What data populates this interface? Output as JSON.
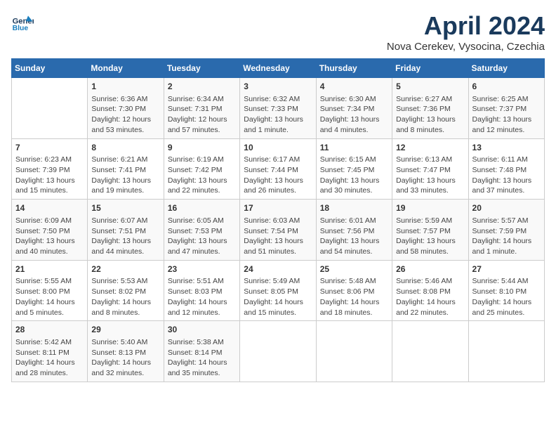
{
  "header": {
    "logo_line1": "General",
    "logo_line2": "Blue",
    "month_title": "April 2024",
    "location": "Nova Cerekev, Vysocina, Czechia"
  },
  "days_of_week": [
    "Sunday",
    "Monday",
    "Tuesday",
    "Wednesday",
    "Thursday",
    "Friday",
    "Saturday"
  ],
  "weeks": [
    [
      {
        "day": "",
        "info": ""
      },
      {
        "day": "1",
        "info": "Sunrise: 6:36 AM\nSunset: 7:30 PM\nDaylight: 12 hours\nand 53 minutes."
      },
      {
        "day": "2",
        "info": "Sunrise: 6:34 AM\nSunset: 7:31 PM\nDaylight: 12 hours\nand 57 minutes."
      },
      {
        "day": "3",
        "info": "Sunrise: 6:32 AM\nSunset: 7:33 PM\nDaylight: 13 hours\nand 1 minute."
      },
      {
        "day": "4",
        "info": "Sunrise: 6:30 AM\nSunset: 7:34 PM\nDaylight: 13 hours\nand 4 minutes."
      },
      {
        "day": "5",
        "info": "Sunrise: 6:27 AM\nSunset: 7:36 PM\nDaylight: 13 hours\nand 8 minutes."
      },
      {
        "day": "6",
        "info": "Sunrise: 6:25 AM\nSunset: 7:37 PM\nDaylight: 13 hours\nand 12 minutes."
      }
    ],
    [
      {
        "day": "7",
        "info": "Sunrise: 6:23 AM\nSunset: 7:39 PM\nDaylight: 13 hours\nand 15 minutes."
      },
      {
        "day": "8",
        "info": "Sunrise: 6:21 AM\nSunset: 7:41 PM\nDaylight: 13 hours\nand 19 minutes."
      },
      {
        "day": "9",
        "info": "Sunrise: 6:19 AM\nSunset: 7:42 PM\nDaylight: 13 hours\nand 22 minutes."
      },
      {
        "day": "10",
        "info": "Sunrise: 6:17 AM\nSunset: 7:44 PM\nDaylight: 13 hours\nand 26 minutes."
      },
      {
        "day": "11",
        "info": "Sunrise: 6:15 AM\nSunset: 7:45 PM\nDaylight: 13 hours\nand 30 minutes."
      },
      {
        "day": "12",
        "info": "Sunrise: 6:13 AM\nSunset: 7:47 PM\nDaylight: 13 hours\nand 33 minutes."
      },
      {
        "day": "13",
        "info": "Sunrise: 6:11 AM\nSunset: 7:48 PM\nDaylight: 13 hours\nand 37 minutes."
      }
    ],
    [
      {
        "day": "14",
        "info": "Sunrise: 6:09 AM\nSunset: 7:50 PM\nDaylight: 13 hours\nand 40 minutes."
      },
      {
        "day": "15",
        "info": "Sunrise: 6:07 AM\nSunset: 7:51 PM\nDaylight: 13 hours\nand 44 minutes."
      },
      {
        "day": "16",
        "info": "Sunrise: 6:05 AM\nSunset: 7:53 PM\nDaylight: 13 hours\nand 47 minutes."
      },
      {
        "day": "17",
        "info": "Sunrise: 6:03 AM\nSunset: 7:54 PM\nDaylight: 13 hours\nand 51 minutes."
      },
      {
        "day": "18",
        "info": "Sunrise: 6:01 AM\nSunset: 7:56 PM\nDaylight: 13 hours\nand 54 minutes."
      },
      {
        "day": "19",
        "info": "Sunrise: 5:59 AM\nSunset: 7:57 PM\nDaylight: 13 hours\nand 58 minutes."
      },
      {
        "day": "20",
        "info": "Sunrise: 5:57 AM\nSunset: 7:59 PM\nDaylight: 14 hours\nand 1 minute."
      }
    ],
    [
      {
        "day": "21",
        "info": "Sunrise: 5:55 AM\nSunset: 8:00 PM\nDaylight: 14 hours\nand 5 minutes."
      },
      {
        "day": "22",
        "info": "Sunrise: 5:53 AM\nSunset: 8:02 PM\nDaylight: 14 hours\nand 8 minutes."
      },
      {
        "day": "23",
        "info": "Sunrise: 5:51 AM\nSunset: 8:03 PM\nDaylight: 14 hours\nand 12 minutes."
      },
      {
        "day": "24",
        "info": "Sunrise: 5:49 AM\nSunset: 8:05 PM\nDaylight: 14 hours\nand 15 minutes."
      },
      {
        "day": "25",
        "info": "Sunrise: 5:48 AM\nSunset: 8:06 PM\nDaylight: 14 hours\nand 18 minutes."
      },
      {
        "day": "26",
        "info": "Sunrise: 5:46 AM\nSunset: 8:08 PM\nDaylight: 14 hours\nand 22 minutes."
      },
      {
        "day": "27",
        "info": "Sunrise: 5:44 AM\nSunset: 8:10 PM\nDaylight: 14 hours\nand 25 minutes."
      }
    ],
    [
      {
        "day": "28",
        "info": "Sunrise: 5:42 AM\nSunset: 8:11 PM\nDaylight: 14 hours\nand 28 minutes."
      },
      {
        "day": "29",
        "info": "Sunrise: 5:40 AM\nSunset: 8:13 PM\nDaylight: 14 hours\nand 32 minutes."
      },
      {
        "day": "30",
        "info": "Sunrise: 5:38 AM\nSunset: 8:14 PM\nDaylight: 14 hours\nand 35 minutes."
      },
      {
        "day": "",
        "info": ""
      },
      {
        "day": "",
        "info": ""
      },
      {
        "day": "",
        "info": ""
      },
      {
        "day": "",
        "info": ""
      }
    ]
  ]
}
